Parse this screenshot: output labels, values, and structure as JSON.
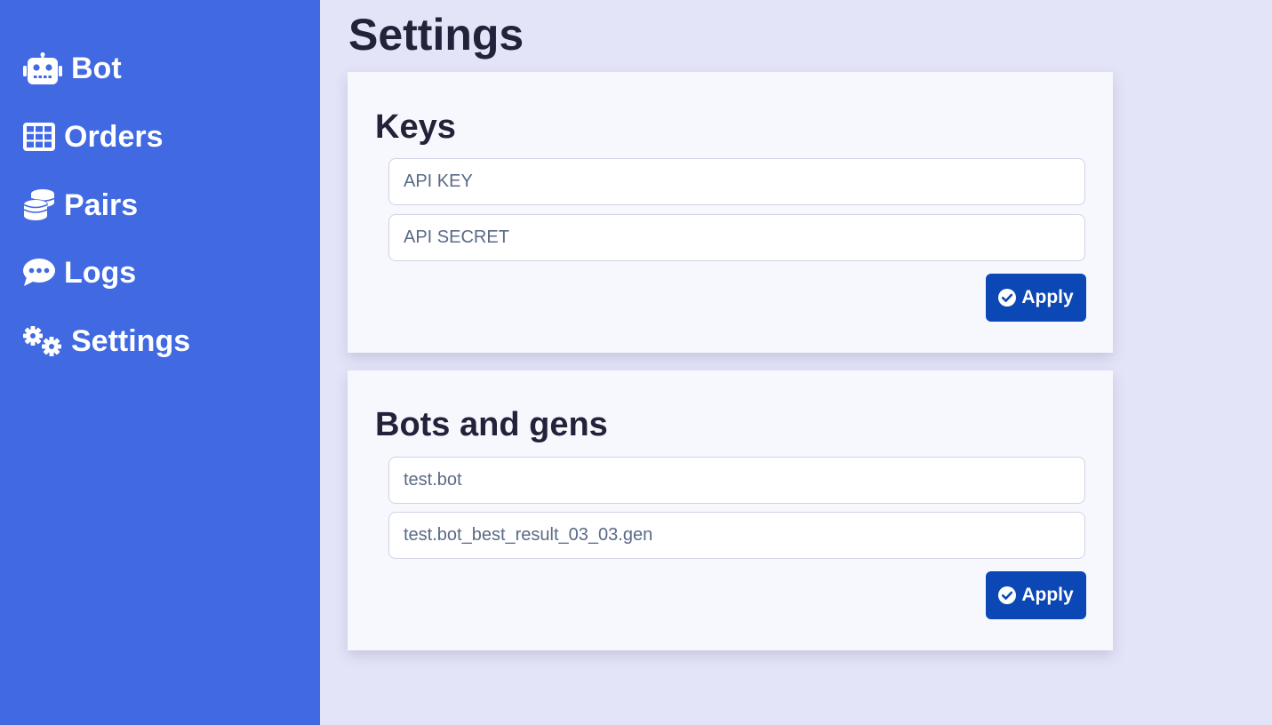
{
  "sidebar": {
    "items": [
      {
        "label": "Bot",
        "icon": "robot-icon"
      },
      {
        "label": "Orders",
        "icon": "table-icon"
      },
      {
        "label": "Pairs",
        "icon": "coins-icon"
      },
      {
        "label": "Logs",
        "icon": "comment-dots-icon"
      },
      {
        "label": "Settings",
        "icon": "cogs-icon"
      }
    ]
  },
  "main": {
    "title": "Settings",
    "keys_card": {
      "title": "Keys",
      "api_key_placeholder": "API KEY",
      "api_secret_placeholder": "API SECRET",
      "apply_label": "Apply"
    },
    "bots_card": {
      "title": "Bots and gens",
      "bot_value": "test.bot",
      "gen_value": "test.bot_best_result_03_03.gen",
      "apply_label": "Apply"
    }
  },
  "colors": {
    "sidebar_bg": "#4169e1",
    "page_bg": "#e4e4f8",
    "card_bg": "#f7f8fd",
    "button_bg": "#0b47b5",
    "title_text": "#22223a"
  }
}
